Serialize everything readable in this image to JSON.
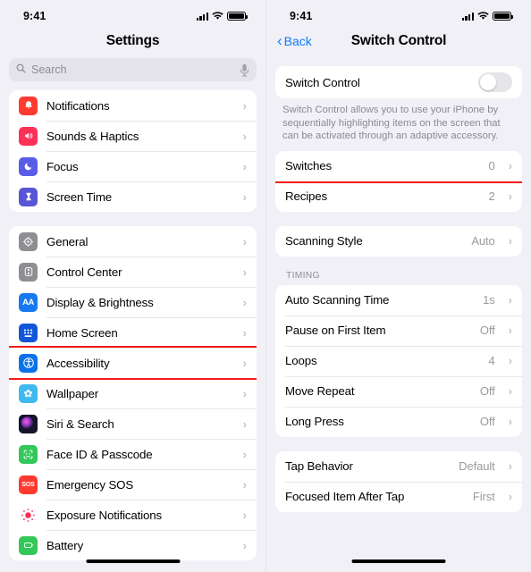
{
  "left": {
    "status": {
      "time": "9:41",
      "signal_icon": "cellular-bars-icon",
      "wifi_icon": "wifi-icon",
      "battery_icon": "battery-full-icon"
    },
    "nav": {
      "title": "Settings"
    },
    "search": {
      "placeholder": "Search",
      "icon": "search-icon",
      "mic_icon": "microphone-icon"
    },
    "groups": [
      {
        "items": [
          {
            "label": "Notifications",
            "icon": "notifications-bell-icon",
            "color": "#ff3b30"
          },
          {
            "label": "Sounds & Haptics",
            "icon": "sounds-speaker-icon",
            "color": "#fc3158"
          },
          {
            "label": "Focus",
            "icon": "focus-moon-icon",
            "color": "#5b5ce6"
          },
          {
            "label": "Screen Time",
            "icon": "screen-time-hourglass-icon",
            "color": "#5856d6"
          }
        ]
      },
      {
        "items": [
          {
            "label": "General",
            "icon": "general-gear-icon",
            "color": "#8e8e93"
          },
          {
            "label": "Control Center",
            "icon": "control-center-toggles-icon",
            "color": "#8e8e93"
          },
          {
            "label": "Display & Brightness",
            "icon": "display-brightness-aa-icon",
            "color": "#1878f0"
          },
          {
            "label": "Home Screen",
            "icon": "home-screen-grid-icon",
            "color": "#1156d8"
          },
          {
            "label": "Accessibility",
            "icon": "accessibility-person-icon",
            "color": "#0a72e8",
            "highlighted": true
          },
          {
            "label": "Wallpaper",
            "icon": "wallpaper-flower-icon",
            "color": "#3fb9f0"
          },
          {
            "label": "Siri & Search",
            "icon": "siri-orb-icon",
            "color": "#1a1a2e"
          },
          {
            "label": "Face ID & Passcode",
            "icon": "face-id-icon",
            "color": "#34c759"
          },
          {
            "label": "Emergency SOS",
            "icon": "emergency-sos-icon",
            "color": "#ff3b30"
          },
          {
            "label": "Exposure Notifications",
            "icon": "exposure-notifications-icon",
            "color": "#fa2f55"
          },
          {
            "label": "Battery",
            "icon": "battery-icon",
            "color": "#34c759"
          }
        ]
      }
    ]
  },
  "right": {
    "status": {
      "time": "9:41",
      "signal_icon": "cellular-bars-icon",
      "wifi_icon": "wifi-icon",
      "battery_icon": "battery-full-icon"
    },
    "nav": {
      "back_label": "Back",
      "back_icon": "chevron-left-icon",
      "title": "Switch Control"
    },
    "toggle_row": {
      "label": "Switch Control",
      "state": "off"
    },
    "footnote": "Switch Control allows you to use your iPhone by sequentially highlighting items on the screen that can be activated through an adaptive accessory.",
    "group_switches": [
      {
        "label": "Switches",
        "value": "0",
        "highlighted": true
      },
      {
        "label": "Recipes",
        "value": "2",
        "highlighted": false
      }
    ],
    "group_scanning": [
      {
        "label": "Scanning Style",
        "value": "Auto"
      }
    ],
    "timing_header": "TIMING",
    "group_timing": [
      {
        "label": "Auto Scanning Time",
        "value": "1s"
      },
      {
        "label": "Pause on First Item",
        "value": "Off"
      },
      {
        "label": "Loops",
        "value": "4"
      },
      {
        "label": "Move Repeat",
        "value": "Off"
      },
      {
        "label": "Long Press",
        "value": "Off"
      }
    ],
    "group_tap": [
      {
        "label": "Tap Behavior",
        "value": "Default"
      },
      {
        "label": "Focused Item After Tap",
        "value": "First"
      }
    ]
  },
  "colors": {
    "highlight": "#f41c1c",
    "accent": "#0a7cff",
    "background": "#f1f0f6"
  }
}
